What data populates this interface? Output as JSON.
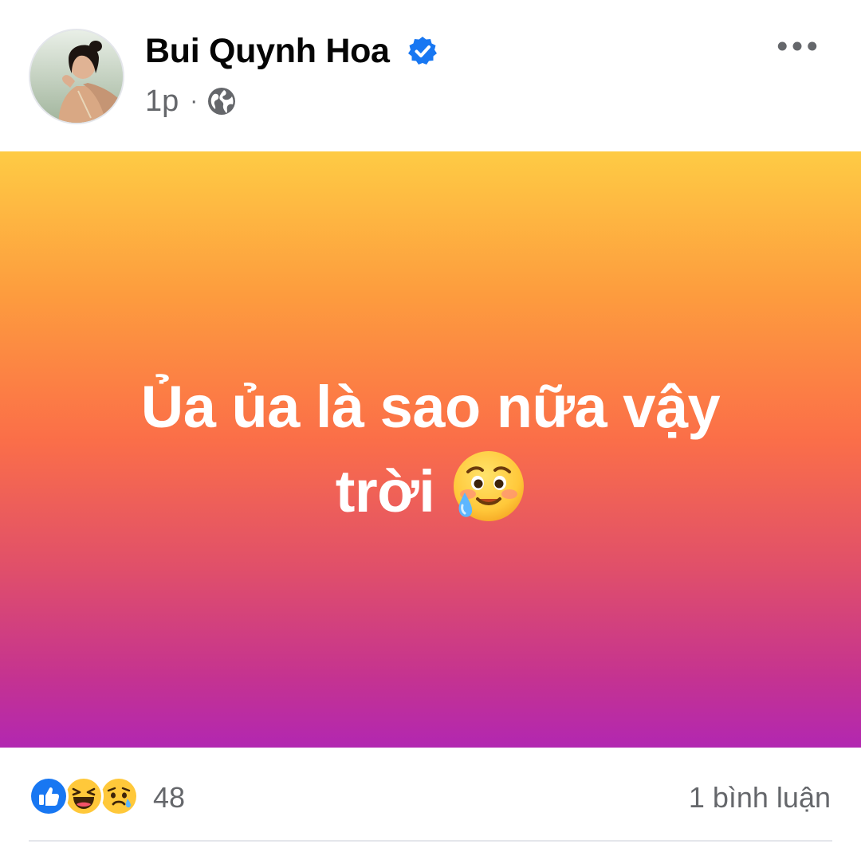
{
  "post": {
    "author_name": "Bui Quynh Hoa",
    "verified": true,
    "time": "1p",
    "separator": "·",
    "privacy_icon": "globe-icon",
    "more_icon": "more-horizontal-icon",
    "text_line1": "Ủa ủa là sao nữa vậy",
    "text_line2": "trời",
    "emoji": "face-holding-back-tears",
    "background_gradient": [
      "#fecb44",
      "#fb6f48",
      "#b227b1"
    ]
  },
  "reactions": {
    "icons": [
      "like-icon",
      "haha-icon",
      "sad-icon"
    ],
    "count": "48",
    "comments_label": "1 bình luận"
  },
  "colors": {
    "verified_blue": "#1877f2",
    "secondary_text": "#65676b",
    "like_blue": "#1877f2"
  }
}
